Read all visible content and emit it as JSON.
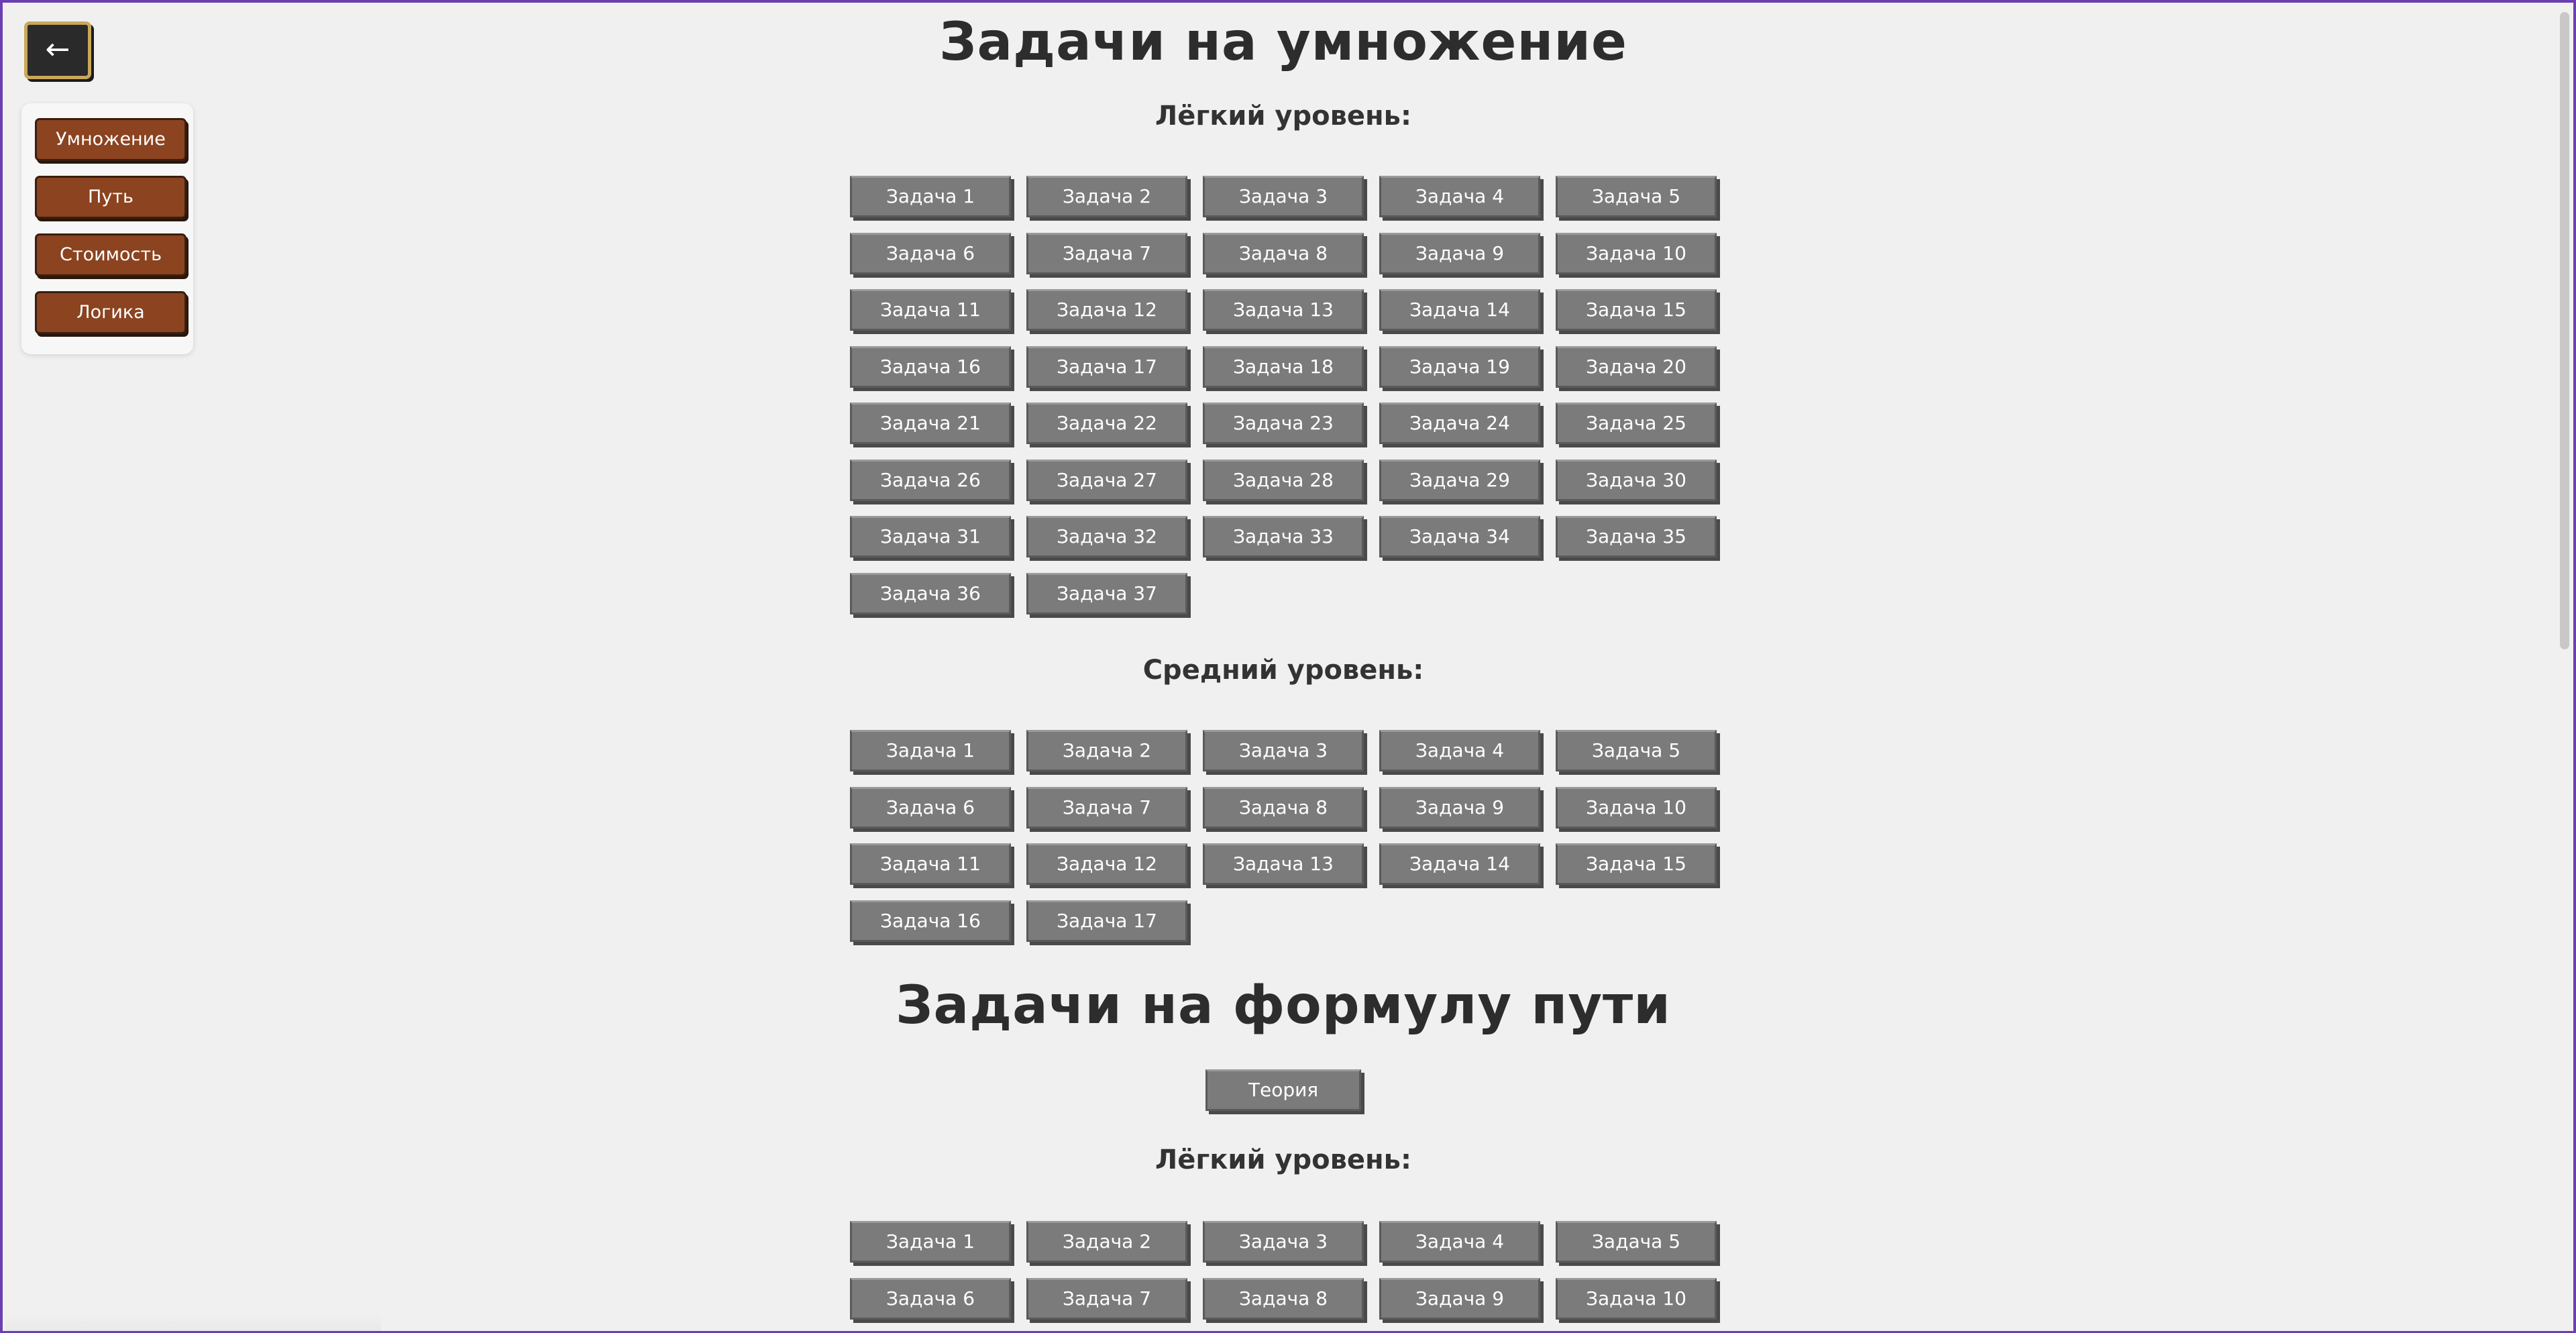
{
  "nav": {
    "back_label": "←",
    "items": [
      {
        "label": "Умножение"
      },
      {
        "label": "Путь"
      },
      {
        "label": "Стоимость"
      },
      {
        "label": "Логика"
      }
    ]
  },
  "sections": [
    {
      "title": "Задачи на умножение",
      "levels": [
        {
          "title": "Лёгкий уровень:",
          "tasks": [
            "Задача 1",
            "Задача 2",
            "Задача 3",
            "Задача 4",
            "Задача 5",
            "Задача 6",
            "Задача 7",
            "Задача 8",
            "Задача 9",
            "Задача 10",
            "Задача 11",
            "Задача 12",
            "Задача 13",
            "Задача 14",
            "Задача 15",
            "Задача 16",
            "Задача 17",
            "Задача 18",
            "Задача 19",
            "Задача 20",
            "Задача 21",
            "Задача 22",
            "Задача 23",
            "Задача 24",
            "Задача 25",
            "Задача 26",
            "Задача 27",
            "Задача 28",
            "Задача 29",
            "Задача 30",
            "Задача 31",
            "Задача 32",
            "Задача 33",
            "Задача 34",
            "Задача 35",
            "Задача 36",
            "Задача 37"
          ]
        },
        {
          "title": "Средний уровень:",
          "tasks": [
            "Задача 1",
            "Задача 2",
            "Задача 3",
            "Задача 4",
            "Задача 5",
            "Задача 6",
            "Задача 7",
            "Задача 8",
            "Задача 9",
            "Задача 10",
            "Задача 11",
            "Задача 12",
            "Задача 13",
            "Задача 14",
            "Задача 15",
            "Задача 16",
            "Задача 17"
          ]
        }
      ]
    },
    {
      "title": "Задачи на формулу пути",
      "theory_label": "Теория",
      "levels": [
        {
          "title": "Лёгкий уровень:",
          "tasks": [
            "Задача 1",
            "Задача 2",
            "Задача 3",
            "Задача 4",
            "Задача 5",
            "Задача 6",
            "Задача 7",
            "Задача 8",
            "Задача 9",
            "Задача 10"
          ]
        }
      ]
    }
  ]
}
